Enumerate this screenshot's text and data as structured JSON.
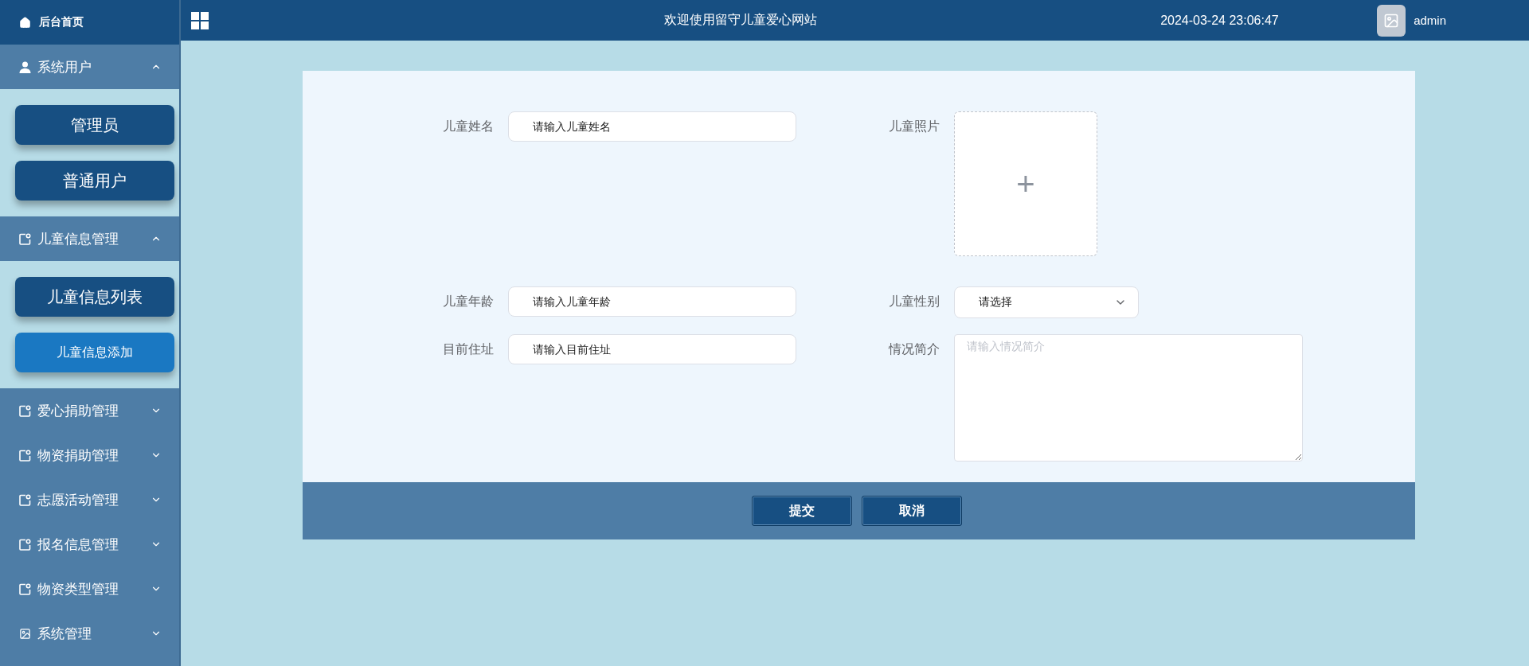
{
  "header": {
    "title": "欢迎使用留守儿童爱心网站",
    "datetime": "2024-03-24 23:06:47",
    "user": "admin"
  },
  "sidebar": {
    "home": "后台首页",
    "groups": [
      {
        "label": "系统用户",
        "expanded": true,
        "children": [
          {
            "label": "管理员",
            "selected": false
          },
          {
            "label": "普通用户",
            "selected": false
          }
        ]
      },
      {
        "label": "儿童信息管理",
        "expanded": true,
        "children": [
          {
            "label": "儿童信息列表",
            "selected": false
          },
          {
            "label": "儿童信息添加",
            "selected": true
          }
        ]
      },
      {
        "label": "爱心捐助管理",
        "expanded": false
      },
      {
        "label": "物资捐助管理",
        "expanded": false
      },
      {
        "label": "志愿活动管理",
        "expanded": false
      },
      {
        "label": "报名信息管理",
        "expanded": false
      },
      {
        "label": "物资类型管理",
        "expanded": false
      },
      {
        "label": "系统管理",
        "expanded": false
      }
    ]
  },
  "form": {
    "fields": [
      {
        "kind": "input",
        "label": "儿童姓名",
        "placeholder": "请输入儿童姓名"
      },
      {
        "kind": "upload",
        "label": "儿童照片",
        "button": "+"
      },
      {
        "kind": "input",
        "label": "儿童年龄",
        "placeholder": "请输入儿童年龄"
      },
      {
        "kind": "select",
        "label": "儿童性别",
        "placeholder": "请选择"
      },
      {
        "kind": "input",
        "label": "目前住址",
        "placeholder": "请输入目前住址"
      },
      {
        "kind": "textarea",
        "label": "情况简介",
        "placeholder": "请输入情况简介"
      }
    ],
    "buttons": [
      "提交",
      "取消"
    ]
  }
}
